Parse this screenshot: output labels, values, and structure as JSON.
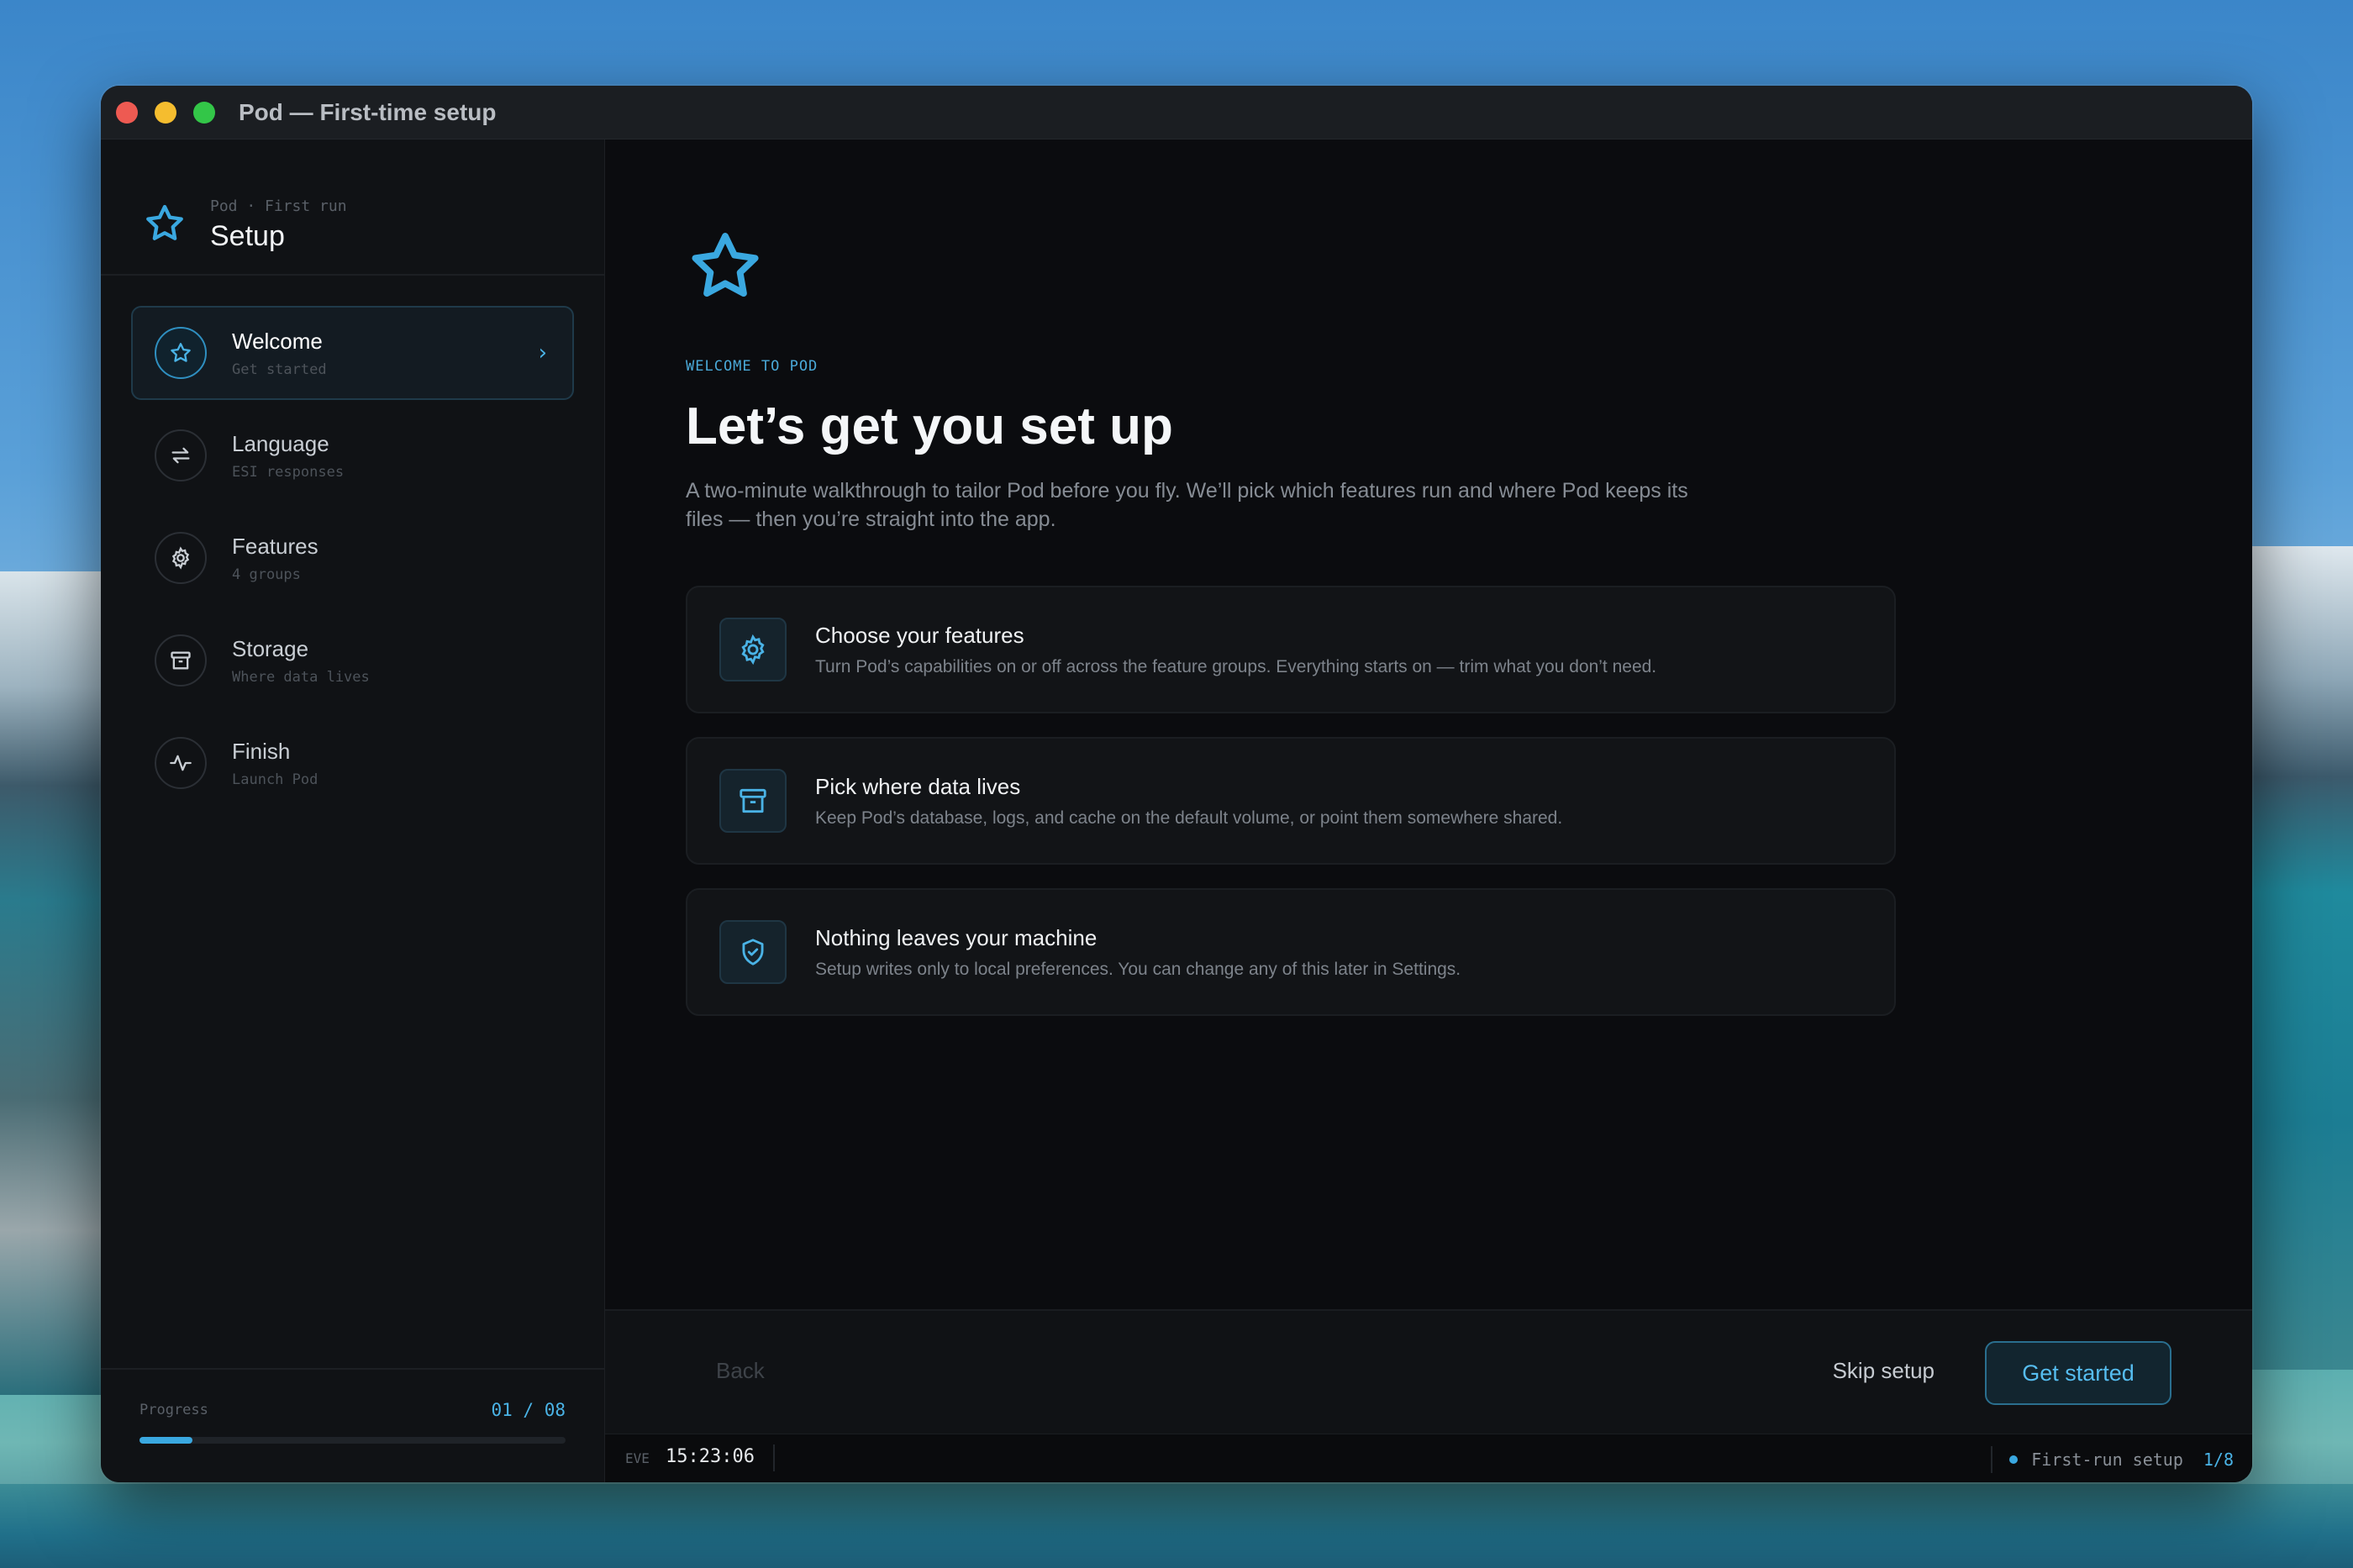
{
  "window": {
    "title": "Pod — First-time setup"
  },
  "sidebar": {
    "crumb": "Pod · First run",
    "title": "Setup",
    "steps": [
      {
        "label": "Welcome",
        "sub": "Get started",
        "icon": "star-icon",
        "active": true
      },
      {
        "label": "Language",
        "sub": "ESI responses",
        "icon": "swap-arrows-icon",
        "active": false
      },
      {
        "label": "Features",
        "sub": "4 groups",
        "icon": "gear-icon",
        "active": false
      },
      {
        "label": "Storage",
        "sub": "Where data lives",
        "icon": "archive-box-icon",
        "active": false
      },
      {
        "label": "Finish",
        "sub": "Launch Pod",
        "icon": "pulse-icon",
        "active": false
      }
    ],
    "progress": {
      "label": "Progress",
      "count": "01 / 08",
      "fraction": 0.125
    }
  },
  "main": {
    "eyebrow": "WELCOME TO POD",
    "headline": "Let’s get you set up",
    "intro": "A two-minute walkthrough to tailor Pod before you fly. We’ll pick which features run and where Pod keeps its files — then you’re straight into the app.",
    "cards": [
      {
        "icon": "gear-icon",
        "title": "Choose your features",
        "desc": "Turn Pod’s capabilities on or off across the feature groups. Everything starts on — trim what you don’t need."
      },
      {
        "icon": "archive-box-icon",
        "title": "Pick where data lives",
        "desc": "Keep Pod’s database, logs, and cache on the default volume, or point them somewhere shared."
      },
      {
        "icon": "shield-check-icon",
        "title": "Nothing leaves your machine",
        "desc": "Setup writes only to local preferences. You can change any of this later in Settings."
      }
    ]
  },
  "actions": {
    "back": "Back",
    "skip": "Skip setup",
    "start": "Get started"
  },
  "statusbar": {
    "zone": "EVE",
    "time": "15:23:06",
    "status": "First-run setup",
    "step": "1/8"
  },
  "colors": {
    "accent": "#3aa8e0",
    "background": "#0b0c0f",
    "sidebar": "#101215"
  }
}
